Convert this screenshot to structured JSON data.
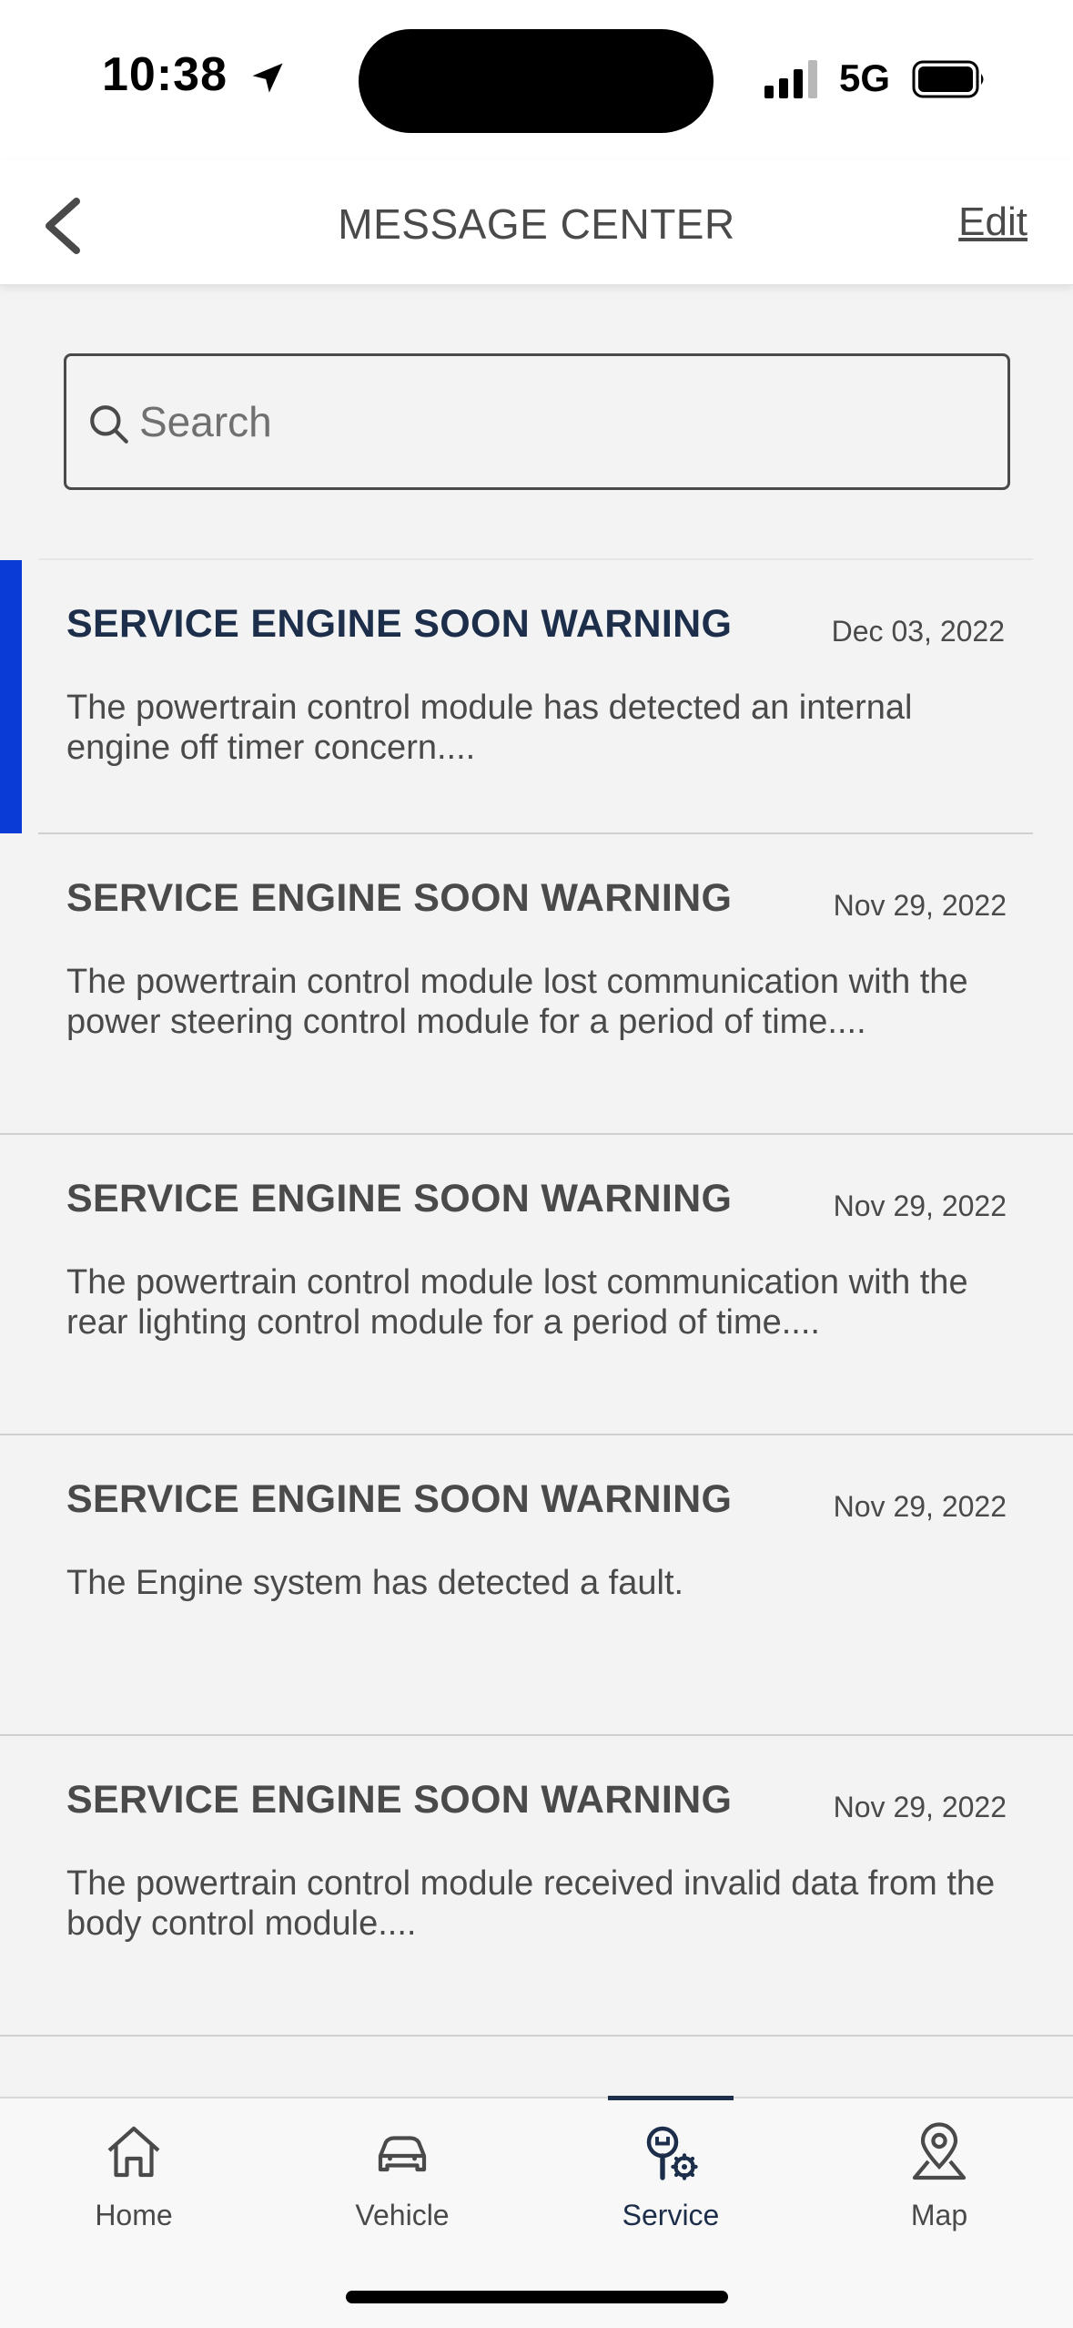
{
  "status_bar": {
    "time": "10:38",
    "network": "5G"
  },
  "header": {
    "title": "MESSAGE CENTER",
    "edit_label": "Edit"
  },
  "search": {
    "placeholder": "Search",
    "value": ""
  },
  "messages": [
    {
      "title": "SERVICE ENGINE SOON WARNING",
      "date": "Dec 03, 2022",
      "body": "The powertrain control module has detected an internal engine off timer concern....",
      "unread": true
    },
    {
      "title": "SERVICE ENGINE SOON WARNING",
      "date": "Nov 29, 2022",
      "body": "The powertrain control module lost communication with the power steering control module for a period of time....",
      "unread": false
    },
    {
      "title": "SERVICE ENGINE SOON WARNING",
      "date": "Nov 29, 2022",
      "body": "The powertrain control module lost communication with the rear lighting control module for a period of time....",
      "unread": false
    },
    {
      "title": "SERVICE ENGINE SOON WARNING",
      "date": "Nov 29, 2022",
      "body": "The Engine system has detected a fault.",
      "unread": false
    },
    {
      "title": "SERVICE ENGINE SOON WARNING",
      "date": "Nov 29, 2022",
      "body": "The powertrain control module received invalid data from the body control module....",
      "unread": false
    }
  ],
  "tabs": [
    {
      "label": "Home",
      "icon": "home-icon",
      "active": false
    },
    {
      "label": "Vehicle",
      "icon": "car-icon",
      "active": false
    },
    {
      "label": "Service",
      "icon": "service-icon",
      "active": true
    },
    {
      "label": "Map",
      "icon": "map-pin-icon",
      "active": false
    }
  ],
  "colors": {
    "unread_accent": "#0b3bd6",
    "active_tab": "#1c2e4a",
    "text": "#4a4a4a"
  }
}
